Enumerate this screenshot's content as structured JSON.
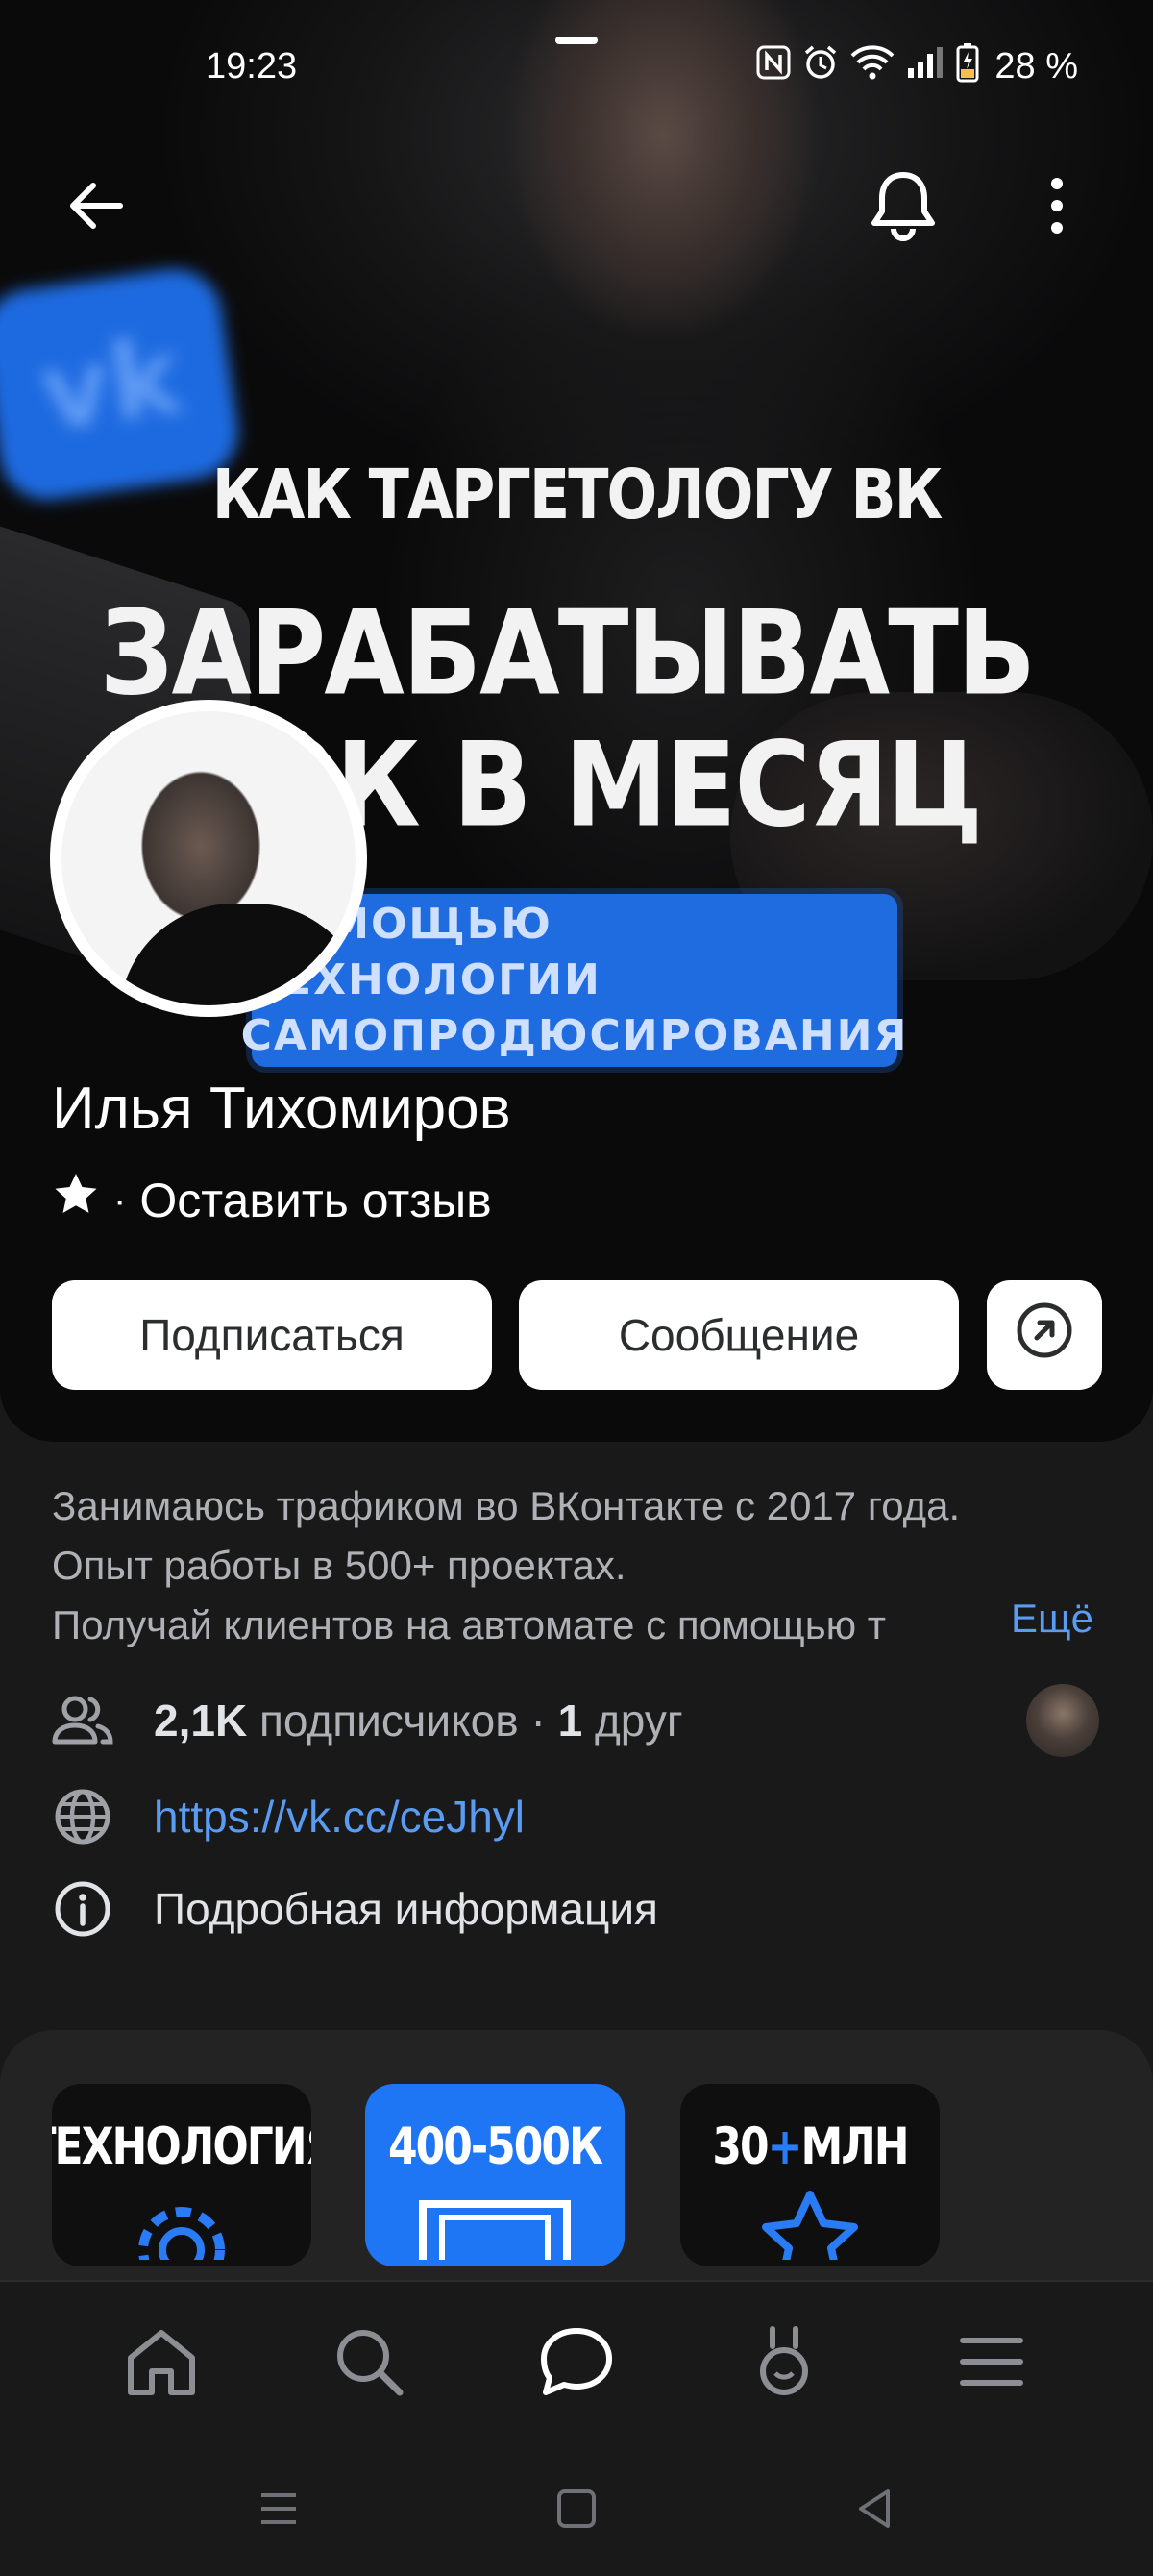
{
  "status_bar": {
    "time": "19:23",
    "battery": "28 %",
    "icons": [
      "nfc-icon",
      "alarm-icon",
      "wifi-icon",
      "signal-icon",
      "battery-icon"
    ]
  },
  "cover": {
    "line1": "КАК ТАРГЕТОЛОГУ ВК",
    "line2": "ЗАРАБАТЫВАТЬ",
    "line3": "500К В МЕСЯЦ",
    "banner_line1": "ПОМОЩЬЮ ТЕХНОЛОГИИ",
    "banner_line2": "САМОПРОДЮСИРОВАНИЯ",
    "vk_logo": "vk"
  },
  "profile": {
    "name": "Илья Тихомиров",
    "review_label": "Оставить отзыв",
    "review_separator": "·"
  },
  "actions": {
    "subscribe": "Подписаться",
    "message": "Сообщение"
  },
  "about": {
    "line1": "Занимаюсь трафиком во ВКонтакте с 2017 года.",
    "line2": "Опыт работы в 500+ проектах.",
    "line3": "Получай клиентов на автомате с помощью т",
    "more": "Ещё",
    "subscribers_count": "2,1K",
    "subscribers_label": "подписчиков",
    "separator": "·",
    "friends_count": "1",
    "friends_label": "друг",
    "link": "https://vk.cc/ceJhyl",
    "details": "Подробная информация"
  },
  "highlights": [
    {
      "title": "ТЕХНОЛОГИЯ"
    },
    {
      "title": "400-500К"
    },
    {
      "title_pre": "30",
      "title_plus": "+",
      "title_post": "МЛН"
    }
  ],
  "colors": {
    "background": "#19191a",
    "card": "#232324",
    "accent_link": "#5b9cf3",
    "button_bg": "#ffffff",
    "brand_blue": "#1f76f5"
  }
}
